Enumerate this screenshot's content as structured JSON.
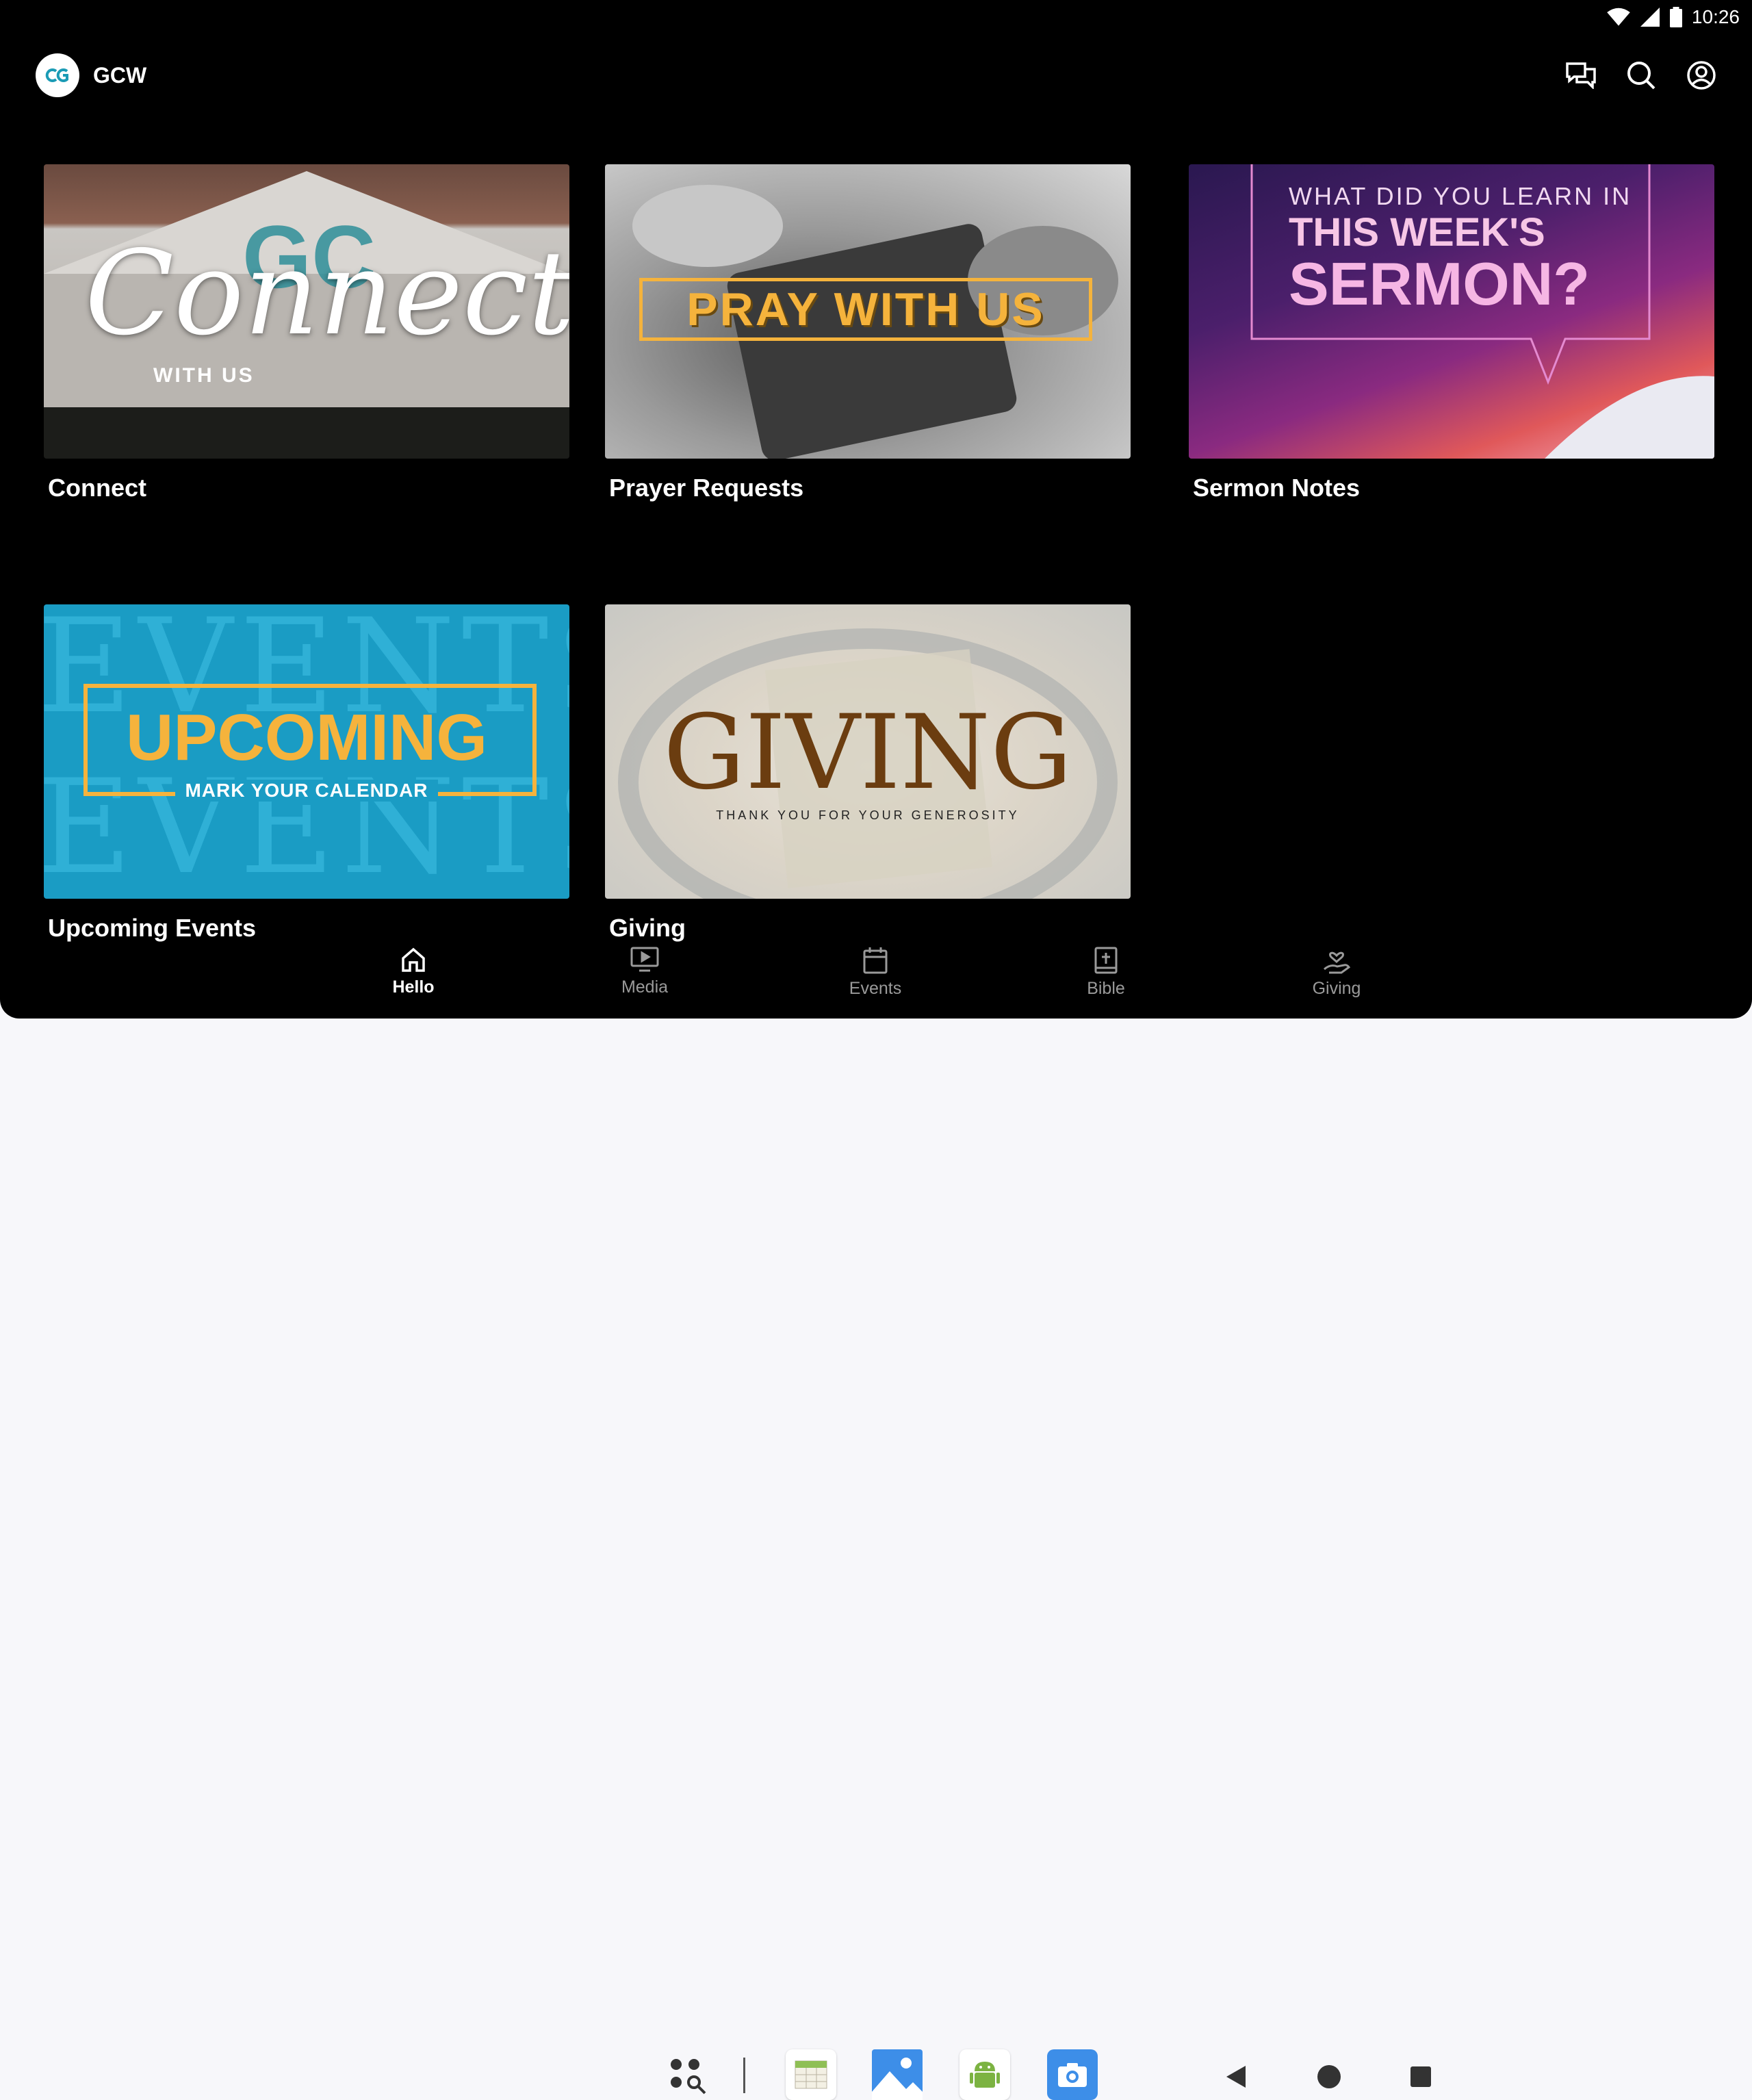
{
  "status_bar": {
    "time": "10:26"
  },
  "app": {
    "title": "GCW",
    "logo_text": "GC"
  },
  "header_actions": [
    {
      "name": "chat-icon"
    },
    {
      "name": "search-icon"
    },
    {
      "name": "account-icon"
    }
  ],
  "cards": [
    {
      "title": "Connect",
      "thumb": {
        "script": "Connect",
        "sub": "WITH US",
        "logo": "GC"
      }
    },
    {
      "title": "Prayer Requests",
      "thumb": {
        "text": "PRAY WITH US"
      }
    },
    {
      "title": "Sermon Notes",
      "thumb": {
        "line1": "WHAT DID YOU LEARN IN",
        "line2": "THIS WEEK'S",
        "line3": "SERMON?"
      }
    },
    {
      "title": "Upcoming Events",
      "thumb": {
        "bg_text": "EVENTS",
        "main": "UPCOMING",
        "sub": "MARK YOUR CALENDAR"
      }
    },
    {
      "title": "Giving",
      "thumb": {
        "main": "GIVING",
        "sub": "THANK YOU FOR YOUR GENEROSITY"
      }
    }
  ],
  "bottom_nav": [
    {
      "label": "Hello",
      "icon": "home-icon",
      "active": true
    },
    {
      "label": "Media",
      "icon": "media-icon",
      "active": false
    },
    {
      "label": "Events",
      "icon": "calendar-icon",
      "active": false
    },
    {
      "label": "Bible",
      "icon": "bible-icon",
      "active": false
    },
    {
      "label": "Giving",
      "icon": "giving-icon",
      "active": false
    }
  ],
  "colors": {
    "app_bg": "#000000",
    "accent_gold": "#f5b33c",
    "events_blue": "#1a9cc4",
    "logo_teal": "#1b9bb5",
    "system_bar": "#f7f7fa"
  }
}
